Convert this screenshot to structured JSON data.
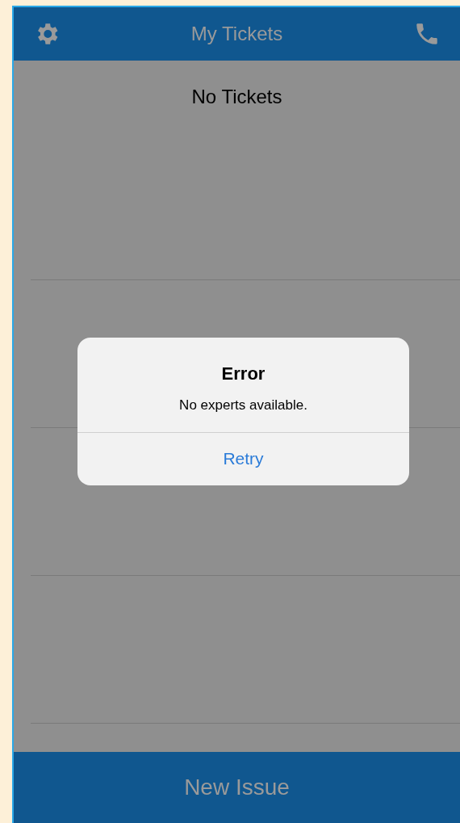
{
  "header": {
    "title": "My Tickets"
  },
  "list": {
    "empty_message": "No Tickets"
  },
  "alert": {
    "title": "Error",
    "message": "No experts available.",
    "buttons": [
      "Retry"
    ]
  },
  "bottom_bar": {
    "button": "New Issue"
  }
}
